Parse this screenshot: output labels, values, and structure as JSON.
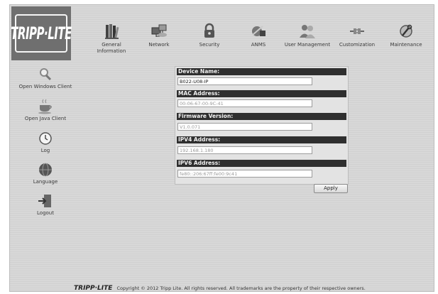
{
  "logo": {
    "text": "TRIPP·LITE"
  },
  "nav": [
    {
      "label": "General Information",
      "icon": "books-icon"
    },
    {
      "label": "Network",
      "icon": "network-icon"
    },
    {
      "label": "Security",
      "icon": "lock-icon"
    },
    {
      "label": "ANMS",
      "icon": "anms-icon"
    },
    {
      "label": "User Management",
      "icon": "users-icon"
    },
    {
      "label": "Customization",
      "icon": "plug-icon"
    },
    {
      "label": "Maintenance",
      "icon": "wrench-icon"
    }
  ],
  "sidebar": [
    {
      "label": "Open Windows Client",
      "icon": "magnifier-icon"
    },
    {
      "label": "Open Java Client",
      "icon": "coffee-cup-icon"
    },
    {
      "label": "Log",
      "icon": "clock-icon"
    },
    {
      "label": "Language",
      "icon": "globe-icon"
    },
    {
      "label": "Logout",
      "icon": "logout-icon"
    }
  ],
  "form": {
    "device_name_label": "Device Name:",
    "device_name_value": "B022-U08-IP",
    "mac_label": "MAC Address:",
    "mac_value": "00-06-67-00-9C-41",
    "firmware_label": "Firmware Version:",
    "firmware_value": "V1.0.071",
    "ipv4_label": "IPV4 Address:",
    "ipv4_value": "192.168.1.180",
    "ipv6_label": "IPV6 Address:",
    "ipv6_value": "fe80::206:67ff:fe00:9c41",
    "apply_label": "Apply"
  },
  "footer": {
    "brand": "TRIPP·LITE",
    "copyright": "Copyright © 2012 Tripp Lite. All rights reserved. All trademarks are the property of their respective owners."
  }
}
